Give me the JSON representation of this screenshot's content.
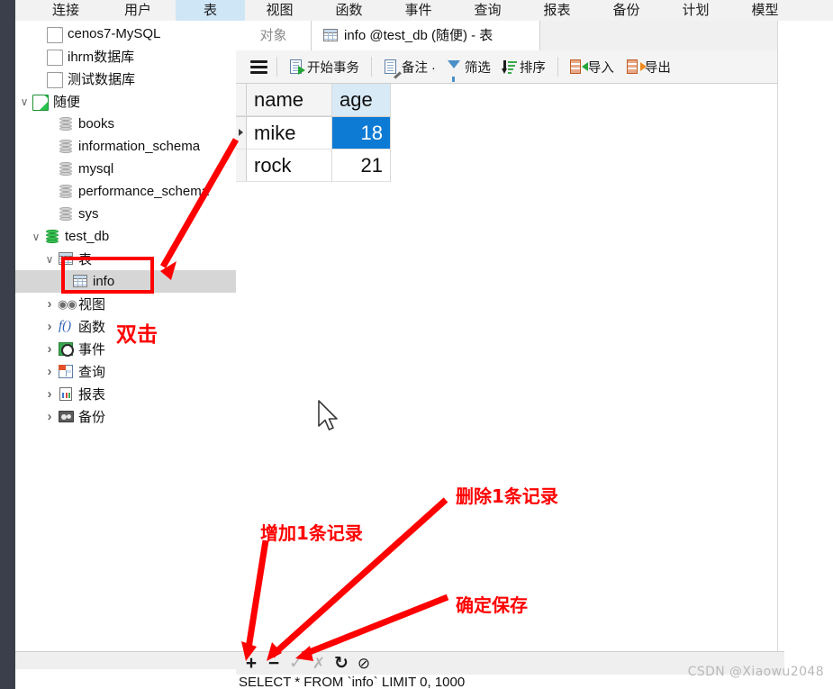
{
  "app": {
    "menu": [
      {
        "label": "连接",
        "name": "connection",
        "active": false
      },
      {
        "label": "用户",
        "name": "user",
        "active": false
      },
      {
        "label": "表",
        "name": "table",
        "active": true
      },
      {
        "label": "视图",
        "name": "view",
        "active": false
      },
      {
        "label": "函数",
        "name": "function",
        "active": false
      },
      {
        "label": "事件",
        "name": "event",
        "active": false
      },
      {
        "label": "查询",
        "name": "query",
        "active": false
      },
      {
        "label": "报表",
        "name": "report",
        "active": false
      },
      {
        "label": "备份",
        "name": "backup",
        "active": false
      },
      {
        "label": "计划",
        "name": "schedule",
        "active": false
      },
      {
        "label": "模型",
        "name": "model",
        "active": false
      }
    ]
  },
  "sidebar": {
    "items": [
      {
        "label": "cenos7-MySQL",
        "icon": "connection-icon",
        "indent": 0,
        "twisty": "none",
        "state": "inactive"
      },
      {
        "label": "ihrm数据库",
        "icon": "connection-icon",
        "indent": 0,
        "twisty": "none",
        "state": "inactive"
      },
      {
        "label": "测试数据库",
        "icon": "connection-icon",
        "indent": 0,
        "twisty": "none",
        "state": "inactive"
      },
      {
        "label": "随便",
        "icon": "connection-icon",
        "indent": 0,
        "twisty": "open",
        "state": "active"
      },
      {
        "label": "books",
        "icon": "database-icon",
        "indent": 1,
        "twisty": "none",
        "state": "inactive"
      },
      {
        "label": "information_schema",
        "icon": "database-icon",
        "indent": 1,
        "twisty": "none",
        "state": "inactive"
      },
      {
        "label": "mysql",
        "icon": "database-icon",
        "indent": 1,
        "twisty": "none",
        "state": "inactive"
      },
      {
        "label": "performance_schema",
        "icon": "database-icon",
        "indent": 1,
        "twisty": "none",
        "state": "inactive"
      },
      {
        "label": "sys",
        "icon": "database-icon",
        "indent": 1,
        "twisty": "none",
        "state": "inactive"
      },
      {
        "label": "test_db",
        "icon": "database-icon",
        "indent": 1,
        "twisty": "open",
        "state": "active"
      },
      {
        "label": "表",
        "icon": "table-grid-icon",
        "indent": 2,
        "twisty": "open",
        "state": "inactive"
      },
      {
        "label": "info",
        "icon": "table-grid-icon",
        "indent": 3,
        "twisty": "none",
        "state": "selected"
      },
      {
        "label": "视图",
        "icon": "view-icon",
        "indent": 2,
        "twisty": "closed",
        "state": "inactive"
      },
      {
        "label": "函数",
        "icon": "function-icon",
        "indent": 2,
        "twisty": "closed",
        "state": "inactive"
      },
      {
        "label": "事件",
        "icon": "event-icon",
        "indent": 2,
        "twisty": "closed",
        "state": "inactive"
      },
      {
        "label": "查询",
        "icon": "query-icon",
        "indent": 2,
        "twisty": "closed",
        "state": "inactive"
      },
      {
        "label": "报表",
        "icon": "report-icon",
        "indent": 2,
        "twisty": "closed",
        "state": "inactive"
      },
      {
        "label": "备份",
        "icon": "backup-icon",
        "indent": 2,
        "twisty": "closed",
        "state": "inactive"
      }
    ]
  },
  "tabs": {
    "object_label": "对象",
    "document_label": "info @test_db (随便) - 表"
  },
  "toolbar": {
    "menu_icon": "hamburger-icon",
    "buttons": [
      {
        "label": "开始事务",
        "icon": "begin-transaction-icon"
      },
      {
        "label": "备注 ·",
        "icon": "note-icon"
      },
      {
        "label": "筛选",
        "icon": "filter-icon"
      },
      {
        "label": "排序",
        "icon": "sort-icon"
      },
      {
        "label": "导入",
        "icon": "import-icon"
      },
      {
        "label": "导出",
        "icon": "export-icon"
      }
    ]
  },
  "grid": {
    "columns": [
      "name",
      "age"
    ],
    "selected_column": "age",
    "rows": [
      {
        "name": "mike",
        "age": "18",
        "current": true
      },
      {
        "name": "rock",
        "age": "21",
        "current": false
      }
    ],
    "selected_cell": {
      "row": 0,
      "column": "age"
    },
    "selection_color": "#0d7ad4",
    "header_selected_color": "#d9eaf7"
  },
  "bottombar": {
    "buttons": [
      {
        "name": "add-record-button",
        "glyph": "+",
        "enabled": true
      },
      {
        "name": "delete-record-button",
        "glyph": "−",
        "enabled": true
      },
      {
        "name": "confirm-save-button",
        "glyph": "✓",
        "enabled": false
      },
      {
        "name": "cancel-edit-button",
        "glyph": "✗",
        "enabled": false
      },
      {
        "name": "refresh-button",
        "glyph": "↻",
        "enabled": true
      },
      {
        "name": "stop-button",
        "glyph": "⊘",
        "enabled": true
      }
    ]
  },
  "sql": {
    "statement": "SELECT * FROM `info` LIMIT 0, 1000"
  },
  "annotations": {
    "color": "#ff0000",
    "double_click": "双击",
    "add_record": "增加1条记录",
    "delete_record": "删除1条记录",
    "confirm_save": "确定保存"
  },
  "watermark": {
    "text": "CSDN @Xiaowu2048"
  }
}
